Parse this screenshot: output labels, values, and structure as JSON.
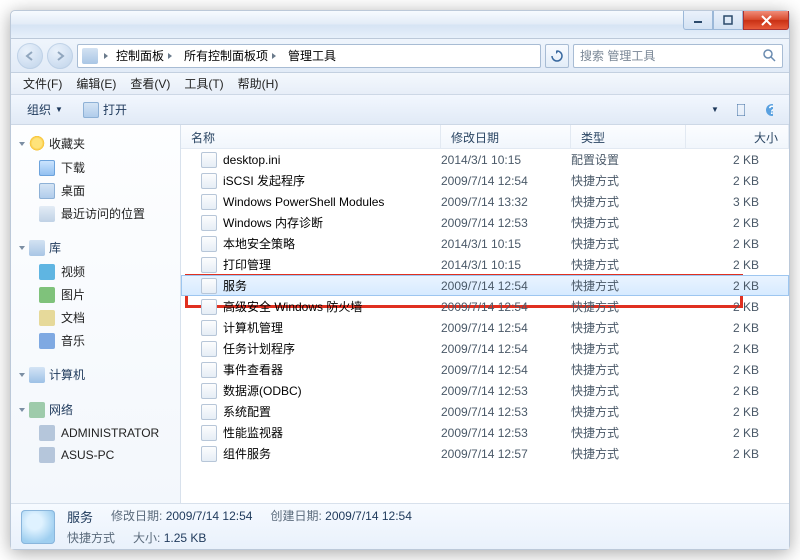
{
  "titlebar": {
    "min": "—",
    "max": "☐",
    "close": "×"
  },
  "address": {
    "crumbs": [
      "控制面板",
      "所有控制面板项",
      "管理工具"
    ],
    "search_placeholder": "搜索 管理工具"
  },
  "menubar": [
    "文件(F)",
    "编辑(E)",
    "查看(V)",
    "工具(T)",
    "帮助(H)"
  ],
  "toolbar": {
    "organize": "组织",
    "open": "打开"
  },
  "nav": {
    "favorites": {
      "label": "收藏夹",
      "items": [
        "下载",
        "桌面",
        "最近访问的位置"
      ]
    },
    "library": {
      "label": "库",
      "items": [
        "视频",
        "图片",
        "文档",
        "音乐"
      ]
    },
    "computer": {
      "label": "计算机"
    },
    "network": {
      "label": "网络",
      "items": [
        "ADMINISTRATOR",
        "ASUS-PC"
      ]
    }
  },
  "columns": {
    "name": "名称",
    "date": "修改日期",
    "type": "类型",
    "size": "大小"
  },
  "files": [
    {
      "name": "desktop.ini",
      "date": "2014/3/1 10:15",
      "type": "配置设置",
      "size": "2 KB"
    },
    {
      "name": "iSCSI 发起程序",
      "date": "2009/7/14 12:54",
      "type": "快捷方式",
      "size": "2 KB"
    },
    {
      "name": "Windows PowerShell Modules",
      "date": "2009/7/14 13:32",
      "type": "快捷方式",
      "size": "3 KB"
    },
    {
      "name": "Windows 内存诊断",
      "date": "2009/7/14 12:53",
      "type": "快捷方式",
      "size": "2 KB"
    },
    {
      "name": "本地安全策略",
      "date": "2014/3/1 10:15",
      "type": "快捷方式",
      "size": "2 KB"
    },
    {
      "name": "打印管理",
      "date": "2014/3/1 10:15",
      "type": "快捷方式",
      "size": "2 KB"
    },
    {
      "name": "服务",
      "date": "2009/7/14 12:54",
      "type": "快捷方式",
      "size": "2 KB",
      "selected": true
    },
    {
      "name": "高级安全 Windows 防火墙",
      "date": "2009/7/14 12:54",
      "type": "快捷方式",
      "size": "2 KB"
    },
    {
      "name": "计算机管理",
      "date": "2009/7/14 12:54",
      "type": "快捷方式",
      "size": "2 KB"
    },
    {
      "name": "任务计划程序",
      "date": "2009/7/14 12:54",
      "type": "快捷方式",
      "size": "2 KB"
    },
    {
      "name": "事件查看器",
      "date": "2009/7/14 12:54",
      "type": "快捷方式",
      "size": "2 KB"
    },
    {
      "name": "数据源(ODBC)",
      "date": "2009/7/14 12:53",
      "type": "快捷方式",
      "size": "2 KB"
    },
    {
      "name": "系统配置",
      "date": "2009/7/14 12:53",
      "type": "快捷方式",
      "size": "2 KB"
    },
    {
      "name": "性能监视器",
      "date": "2009/7/14 12:53",
      "type": "快捷方式",
      "size": "2 KB"
    },
    {
      "name": "组件服务",
      "date": "2009/7/14 12:57",
      "type": "快捷方式",
      "size": "2 KB"
    }
  ],
  "status": {
    "title": "服务",
    "type_label": "快捷方式",
    "mod_k": "修改日期:",
    "mod_v": "2009/7/14 12:54",
    "create_k": "创建日期:",
    "create_v": "2009/7/14 12:54",
    "size_k": "大小:",
    "size_v": "1.25 KB"
  }
}
